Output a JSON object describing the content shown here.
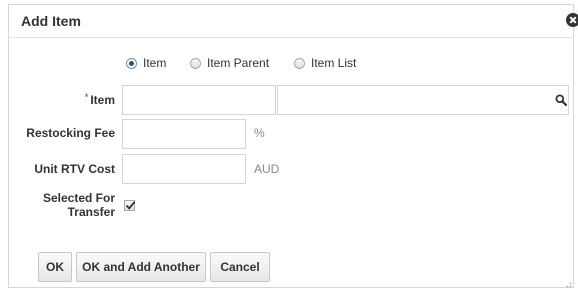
{
  "dialog": {
    "title": "Add Item",
    "close_icon": "close-circle-icon"
  },
  "type_options": {
    "selected": "Item",
    "items": [
      {
        "label": "Item",
        "selected": true
      },
      {
        "label": "Item Parent",
        "selected": false
      },
      {
        "label": "Item List",
        "selected": false
      }
    ]
  },
  "form": {
    "item": {
      "label": "Item",
      "required": true,
      "value": "",
      "description": "",
      "search_icon": "magnifier-icon"
    },
    "restocking_fee": {
      "label": "Restocking Fee",
      "value": "",
      "unit": "%"
    },
    "unit_rtv_cost": {
      "label": "Unit RTV Cost",
      "value": "",
      "unit": "AUD"
    },
    "selected_for_transfer": {
      "label_line1": "Selected For",
      "label_line2": "Transfer",
      "checked": true
    }
  },
  "buttons": {
    "ok": "OK",
    "ok_add_another": "OK and Add Another",
    "cancel": "Cancel"
  },
  "colors": {
    "required_star": "#4a86c6",
    "radio_selected": "#2d4f7c"
  }
}
